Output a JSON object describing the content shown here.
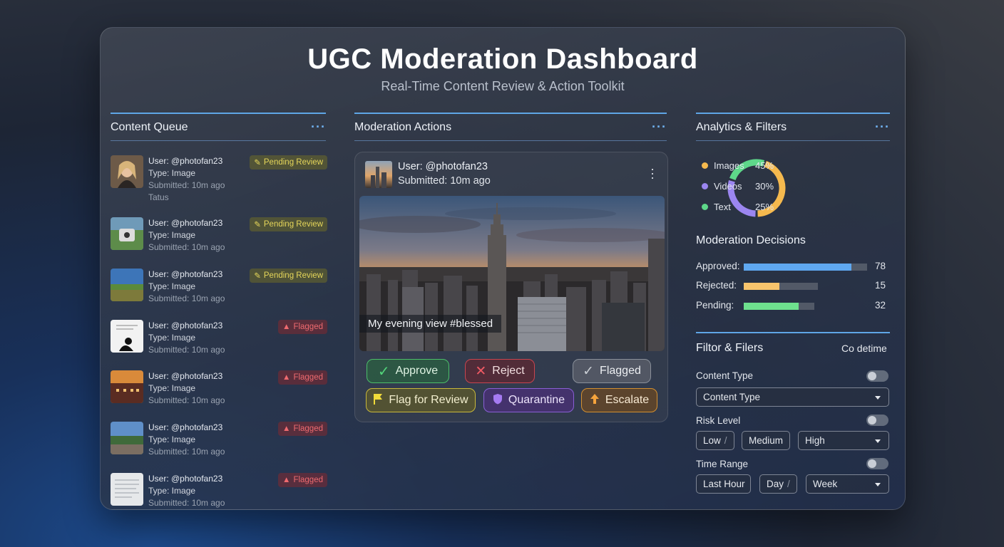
{
  "header": {
    "title": "UGC Moderation Dashboard",
    "subtitle": "Real-Time Content Review & Action Toolkit"
  },
  "queue": {
    "title": "Content Queue",
    "items": [
      {
        "user": "User: @photofan23",
        "type": "Type: Image",
        "submitted": "Submitted: 10m ago",
        "extra": "Tatus",
        "status": "Pending Review",
        "status_kind": "pending"
      },
      {
        "user": "User: @photofan23",
        "type": "Type: Image",
        "submitted": "Submitted: 10m ago",
        "status": "Pending Review",
        "status_kind": "pending"
      },
      {
        "user": "User: @photofan23",
        "type": "Type: Image",
        "submitted": "Submitted: 10m ago",
        "status": "Pending Review",
        "status_kind": "pending"
      },
      {
        "user": "User: @photofan23",
        "type": "Type: Image",
        "submitted": "Submitted: 10m ago",
        "status": "Flagged",
        "status_kind": "flagged"
      },
      {
        "user": "User: @photofan23",
        "type": "Type: Image",
        "submitted": "Submitted: 10m ago",
        "status": "Flagged",
        "status_kind": "flagged"
      },
      {
        "user": "User: @photofan23",
        "type": "Type: Image",
        "submitted": "Submitted: 10m ago",
        "status": "Flagged",
        "status_kind": "flagged"
      },
      {
        "user": "User: @photofan23",
        "type": "Type: Image",
        "submitted": "Submitted: 10m ago",
        "status": "Flagged",
        "status_kind": "flagged"
      }
    ]
  },
  "actions": {
    "title": "Moderation Actions",
    "post": {
      "user": "User: @photofan23",
      "submitted": "Submitted: 10m ago",
      "caption": "My evening view #blessed"
    },
    "buttons": {
      "approve": "Approve",
      "reject": "Reject",
      "flagged": "Flagged",
      "flag_review": "Flag for Review",
      "quarantine": "Quarantine",
      "escalate": "Escalate"
    }
  },
  "analytics": {
    "title": "Analytics & Filters",
    "chart_data": {
      "type": "pie",
      "categories": [
        "Images",
        "Videos",
        "Text"
      ],
      "values": [
        45,
        30,
        25
      ],
      "labels": [
        "45%",
        "30%",
        "25%"
      ],
      "colors": [
        "#f5b94e",
        "#9b86f0",
        "#5ed88a"
      ]
    },
    "decisions_title": "Moderation Decisions",
    "decisions": [
      {
        "label": "Approved:",
        "value": 78,
        "display": "78",
        "fraction": 0.87,
        "color": "#5fa8f0"
      },
      {
        "label": "Rejected:",
        "value": 15,
        "display": "15",
        "fraction": 0.48,
        "color": "#f7c46c"
      },
      {
        "label": "Pending:",
        "value": 32,
        "display": "32",
        "fraction": 0.78,
        "color": "#6ee08e"
      }
    ],
    "filters_title": "Filtor & Filers",
    "filters_aside": "Co detime",
    "content_type_label": "Content Type",
    "content_type_value": "Content Type",
    "risk_label": "Risk Level",
    "risk_low": "Low",
    "risk_low_sep": "/",
    "risk_medium": "Medium",
    "risk_high": "High",
    "time_label": "Time Range",
    "time_last_hour": "Last Hour",
    "time_day": "Day",
    "time_day_sep": "/",
    "time_week": "Week"
  },
  "icons": {
    "panel_menu": "more-horizontal-icon",
    "post_menu": "more-vertical-icon",
    "pending": "pencil-icon",
    "flagged": "alert-icon"
  }
}
